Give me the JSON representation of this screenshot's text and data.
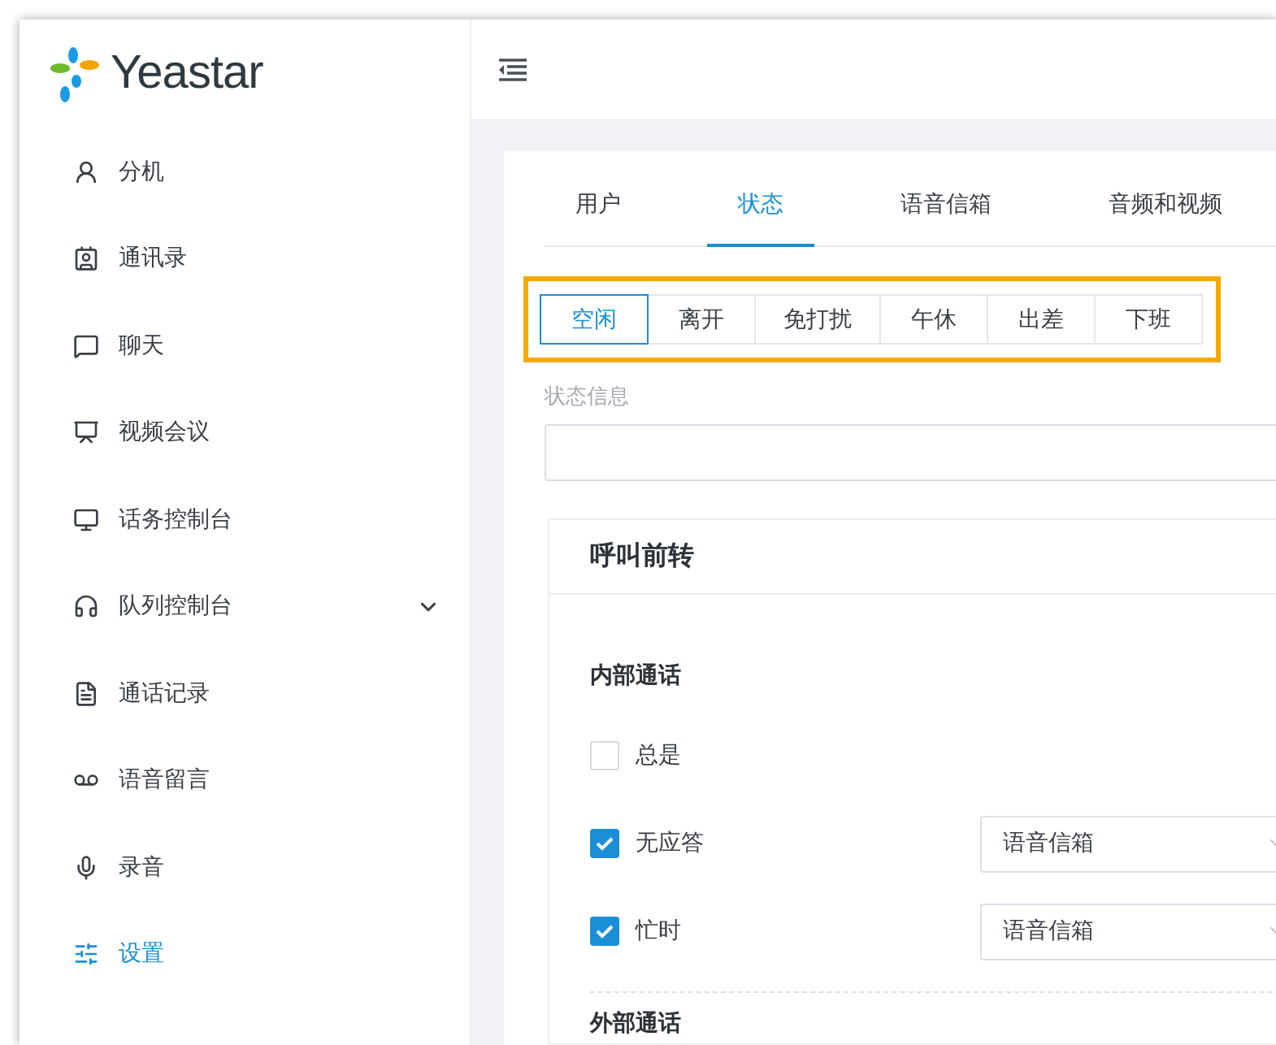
{
  "logo": {
    "text": "Yeastar"
  },
  "sidebar": {
    "items": [
      {
        "label": "分机",
        "kind": "link",
        "selected": false
      },
      {
        "label": "通讯录",
        "kind": "link",
        "selected": false
      },
      {
        "label": "聊天",
        "kind": "link",
        "selected": false
      },
      {
        "label": "视频会议",
        "kind": "link",
        "selected": false
      },
      {
        "label": "话务控制台",
        "kind": "link",
        "selected": false
      },
      {
        "label": "队列控制台",
        "kind": "group",
        "selected": false
      },
      {
        "label": "通话记录",
        "kind": "link",
        "selected": false
      },
      {
        "label": "语音留言",
        "kind": "link",
        "selected": false
      },
      {
        "label": "录音",
        "kind": "link",
        "selected": false
      },
      {
        "label": "设置",
        "kind": "link",
        "selected": true
      }
    ]
  },
  "tabs": [
    {
      "label": "用户",
      "selected": false
    },
    {
      "label": "状态",
      "selected": true
    },
    {
      "label": "语音信箱",
      "selected": false
    },
    {
      "label": "音频和视频",
      "selected": false
    }
  ],
  "status_options": [
    {
      "label": "空闲",
      "selected": true
    },
    {
      "label": "离开",
      "selected": false
    },
    {
      "label": "免打扰",
      "selected": false
    },
    {
      "label": "午休",
      "selected": false
    },
    {
      "label": "出差",
      "selected": false
    },
    {
      "label": "下班",
      "selected": false
    }
  ],
  "status_message": {
    "label": "状态信息"
  },
  "call_forwarding": {
    "title": "呼叫前转",
    "sections": [
      {
        "title": "内部通话",
        "rules": [
          {
            "label": "总是",
            "checked": false
          },
          {
            "label": "无应答",
            "checked": true,
            "destination": "语音信箱"
          },
          {
            "label": "忙时",
            "checked": true,
            "destination": "语音信箱"
          }
        ]
      },
      {
        "title": "外部通话"
      }
    ]
  }
}
